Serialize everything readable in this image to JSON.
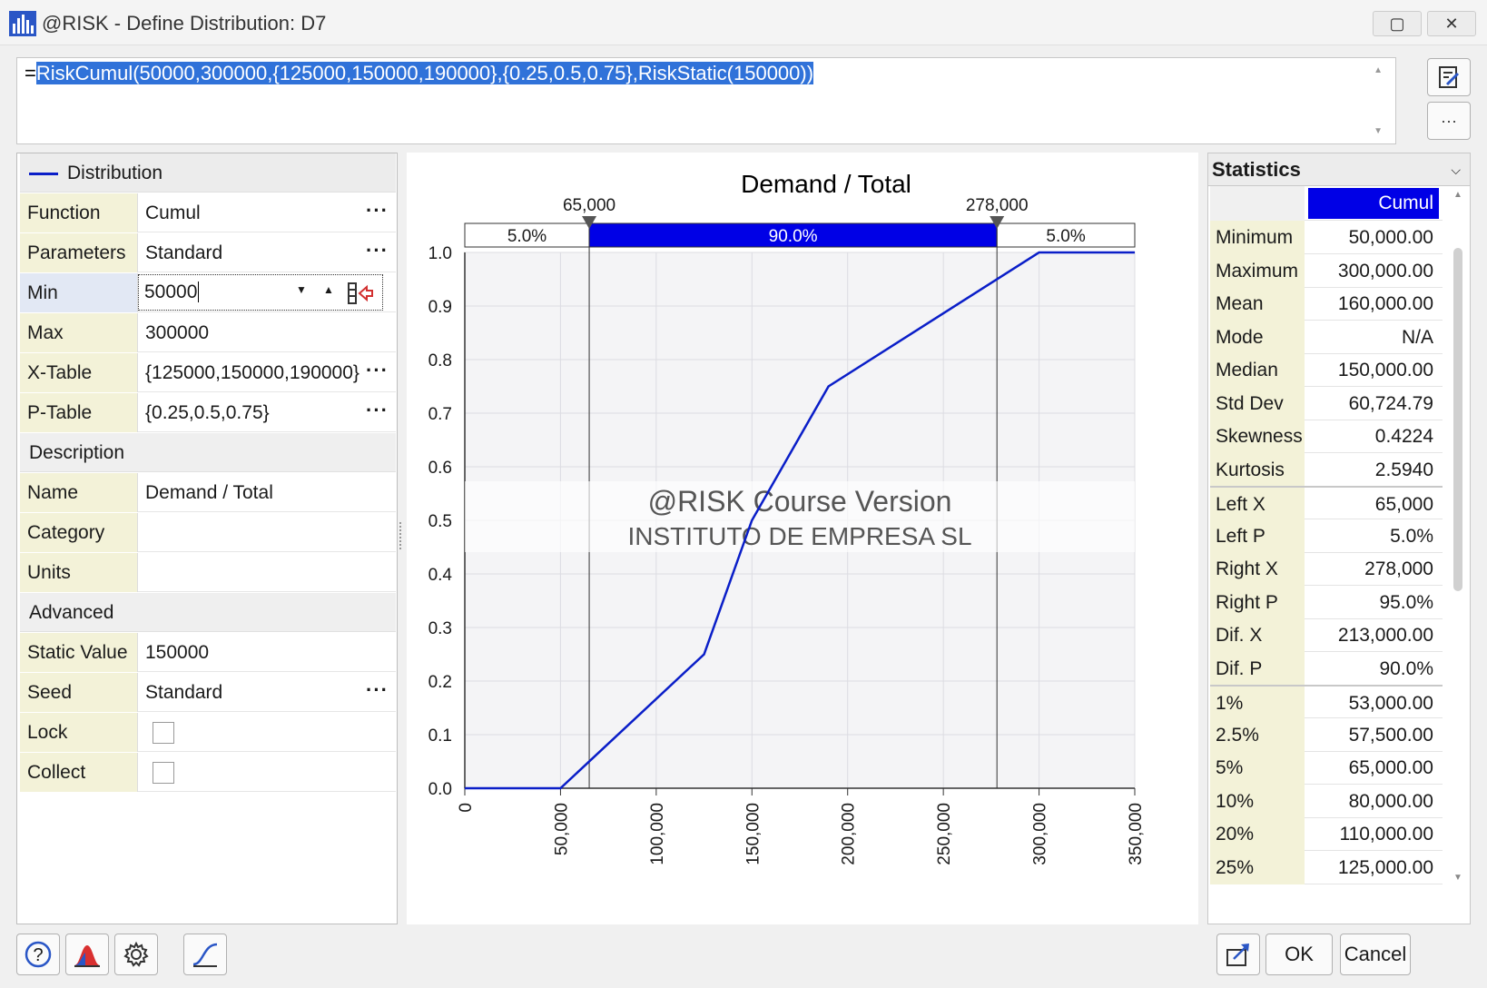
{
  "window": {
    "title": "@RISK - Define Distribution: D7"
  },
  "formula": {
    "prefix": "=",
    "text": "RiskCumul(50000,300000,{125000,150000,190000},{0.25,0.5,0.75},RiskStatic(150000))"
  },
  "left_panel": {
    "header": "Distribution",
    "rows": [
      {
        "label": "Function",
        "value": "Cumul",
        "dots": "···"
      },
      {
        "label": "Parameters",
        "value": "Standard",
        "dots": "···"
      },
      {
        "label": "Min",
        "value": "50000"
      },
      {
        "label": "Max",
        "value": "300000"
      },
      {
        "label": "X-Table",
        "value": "{125000,150000,190000}",
        "dots": "···"
      },
      {
        "label": "P-Table",
        "value": "{0.25,0.5,0.75}",
        "dots": "···"
      }
    ],
    "description_header": "Description",
    "desc_rows": [
      {
        "label": "Name",
        "value": "Demand / Total"
      },
      {
        "label": "Category",
        "value": ""
      },
      {
        "label": "Units",
        "value": ""
      }
    ],
    "advanced_header": "Advanced",
    "adv_rows": [
      {
        "label": "Static Value",
        "value": "150000"
      },
      {
        "label": "Seed",
        "value": "Standard",
        "dots": "···"
      },
      {
        "label": "Lock",
        "value": ""
      },
      {
        "label": "Collect",
        "value": ""
      }
    ]
  },
  "chart_data": {
    "type": "line",
    "title": "Demand / Total",
    "x": [
      0,
      50000,
      125000,
      150000,
      190000,
      300000,
      350000
    ],
    "y": [
      0,
      0,
      0.25,
      0.5,
      0.75,
      1.0,
      1.0
    ],
    "xlim": [
      0,
      350000
    ],
    "ylim": [
      0,
      1.0
    ],
    "x_ticks": [
      "0",
      "50,000",
      "100,000",
      "150,000",
      "200,000",
      "250,000",
      "300,000",
      "350,000"
    ],
    "y_ticks": [
      "0.0",
      "0.1",
      "0.2",
      "0.3",
      "0.4",
      "0.5",
      "0.6",
      "0.7",
      "0.8",
      "0.9",
      "1.0"
    ],
    "left_marker": {
      "x": 65000,
      "label": "65,000"
    },
    "right_marker": {
      "x": 278000,
      "label": "278,000"
    },
    "bands": {
      "left": "5.0%",
      "middle": "90.0%",
      "right": "5.0%"
    },
    "watermark": [
      "@RISK Course Version",
      "INSTITUTO DE EMPRESA SL"
    ],
    "line_color": "#0a1ec8",
    "band_color": "#0000e6",
    "grid": true
  },
  "statistics": {
    "header": "Statistics",
    "column": "Cumul",
    "rows": [
      {
        "label": "Minimum",
        "value": "50,000.00"
      },
      {
        "label": "Maximum",
        "value": "300,000.00"
      },
      {
        "label": "Mean",
        "value": "160,000.00"
      },
      {
        "label": "Mode",
        "value": "N/A"
      },
      {
        "label": "Median",
        "value": "150,000.00"
      },
      {
        "label": "Std Dev",
        "value": "60,724.79"
      },
      {
        "label": "Skewness",
        "value": "0.4224"
      },
      {
        "label": "Kurtosis",
        "value": "2.5940"
      },
      {
        "label": "Left X",
        "value": "65,000"
      },
      {
        "label": "Left P",
        "value": "5.0%"
      },
      {
        "label": "Right X",
        "value": "278,000"
      },
      {
        "label": "Right P",
        "value": "95.0%"
      },
      {
        "label": "Dif. X",
        "value": "213,000.00"
      },
      {
        "label": "Dif. P",
        "value": "90.0%"
      },
      {
        "label": "1%",
        "value": "53,000.00"
      },
      {
        "label": "2.5%",
        "value": "57,500.00"
      },
      {
        "label": "5%",
        "value": "65,000.00"
      },
      {
        "label": "10%",
        "value": "80,000.00"
      },
      {
        "label": "20%",
        "value": "110,000.00"
      },
      {
        "label": "25%",
        "value": "125,000.00"
      }
    ]
  },
  "buttons": {
    "ok": "OK",
    "cancel": "Cancel"
  }
}
